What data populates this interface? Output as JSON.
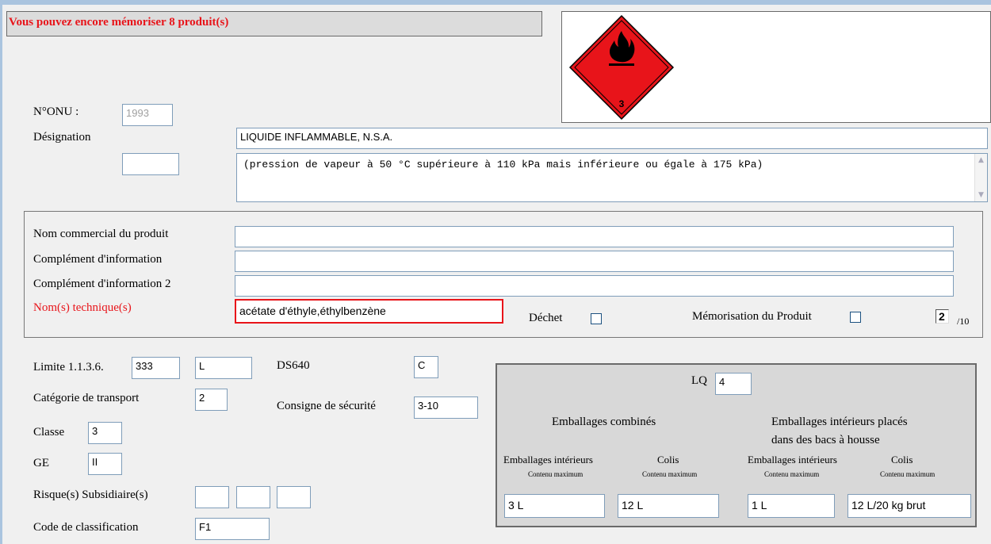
{
  "banner": "Vous pouvez encore mémoriser 8 produit(s)",
  "placard": {
    "class_number": "3",
    "icon": "flame-icon",
    "color": "#e8141a"
  },
  "onu": {
    "label": "N°ONU :",
    "value": "1993"
  },
  "designation": {
    "label": "Désignation",
    "name": "LIQUIDE INFLAMMABLE, N.S.A.",
    "detail": "(pression de vapeur à 50 °C supérieure à 110 kPa mais inférieure ou égale à 175 kPa)",
    "side_value": ""
  },
  "product": {
    "commercial_name_label": "Nom commercial du produit",
    "commercial_name": "",
    "complement_label": "Complément d'information",
    "complement": "",
    "complement2_label": "Complément d'information 2",
    "complement2": "",
    "technical_label": "Nom(s) technique(s)",
    "technical": "acétate d'éthyle,éthylbenzène",
    "waste_label": "Déchet",
    "memorize_label": "Mémorisation du Produit",
    "counter_value": "2",
    "counter_total": "/10"
  },
  "limits": {
    "limit_label": "Limite 1.1.3.6.",
    "limit_value": "333",
    "limit_unit": "L",
    "ds_label": "DS640",
    "ds_value": "C",
    "transport_cat_label": "Catégorie de transport",
    "transport_cat": "2",
    "safety_label": "Consigne de sécurité",
    "safety_value": "3-10",
    "class_label": "Classe",
    "class_value": "3",
    "ge_label": "GE",
    "ge_value": "II",
    "subsid_label": "Risque(s) Subsidiaire(s)",
    "subsid": [
      "",
      "",
      ""
    ],
    "classif_label": "Code de classification",
    "classif_value": "F1"
  },
  "lq": {
    "label": "LQ",
    "value": "4",
    "combined_title": "Emballages combinés",
    "tray_title_1": "Emballages intérieurs placés",
    "tray_title_2": "dans des bacs à housse",
    "inner_label": "Emballages intérieurs",
    "colis_label": "Colis",
    "max_label": "Contenu maximum",
    "combined_inner": "3 L",
    "combined_colis": "12 L",
    "tray_inner": "1 L",
    "tray_colis": "12 L/20 kg brut"
  }
}
